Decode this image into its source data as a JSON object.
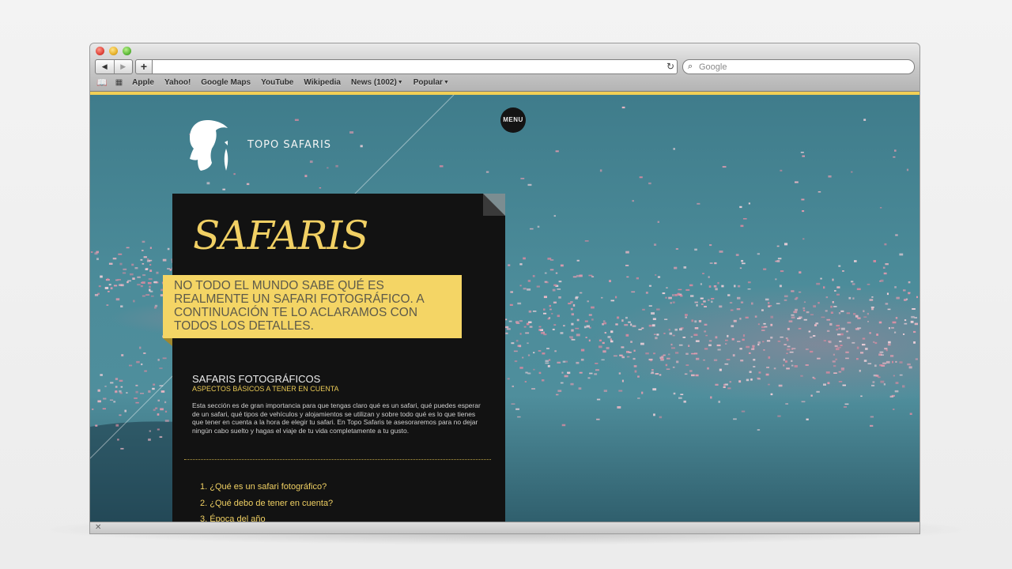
{
  "browser": {
    "nav": {
      "back_glyph": "◀",
      "forward_glyph": "▶",
      "add_glyph": "+",
      "reload_glyph": "↻"
    },
    "search": {
      "placeholder": "Google",
      "icon": "magnifier-icon"
    },
    "bookmarks": [
      {
        "label": "Apple"
      },
      {
        "label": "Yahoo!"
      },
      {
        "label": "Google Maps"
      },
      {
        "label": "YouTube"
      },
      {
        "label": "Wikipedia"
      },
      {
        "label": "News (1002)",
        "dropdown": true
      },
      {
        "label": "Popular",
        "dropdown": true
      }
    ],
    "status": {
      "close_glyph": "✕"
    }
  },
  "site": {
    "logo_text": "TOPO SAFARIS",
    "menu_label": "MENU",
    "panel": {
      "title": "SAFARIS",
      "intro": "NO TODO EL MUNDO SABE QUÉ ES REALMENTE UN SAFARI FOTOGRÁFICO. A CONTINUACIÓN TE LO ACLARAMOS CON TODOS LOS DETALLES.",
      "section_title": "SAFARIS FOTOGRÁFICOS",
      "section_subtitle": "ASPECTOS BÁSICOS A TENER EN CUENTA",
      "section_body": "Esta sección es de gran importancia para que tengas claro qué es un safari, qué puedes esperar de un safari, qué tipos de vehículos y alojamientos se utilizan y sobre todo qué es lo que tienes que tener en cuenta a la hora de elegir tu safari. En Topo Safaris te asesoraremos para no dejar ningún cabo suelto y hagas el viaje de tu vida completamente a tu gusto.",
      "toc": [
        "1. ¿Qué es un safari fotográfico?",
        "2. ¿Qué debo de tener en cuenta?",
        "3. Época del año"
      ]
    }
  },
  "colors": {
    "accent_yellow": "#f1d064",
    "panel_bg": "#121212",
    "sky_teal": "#4c8c9a",
    "flamingo_pink": "#e79cb0"
  }
}
